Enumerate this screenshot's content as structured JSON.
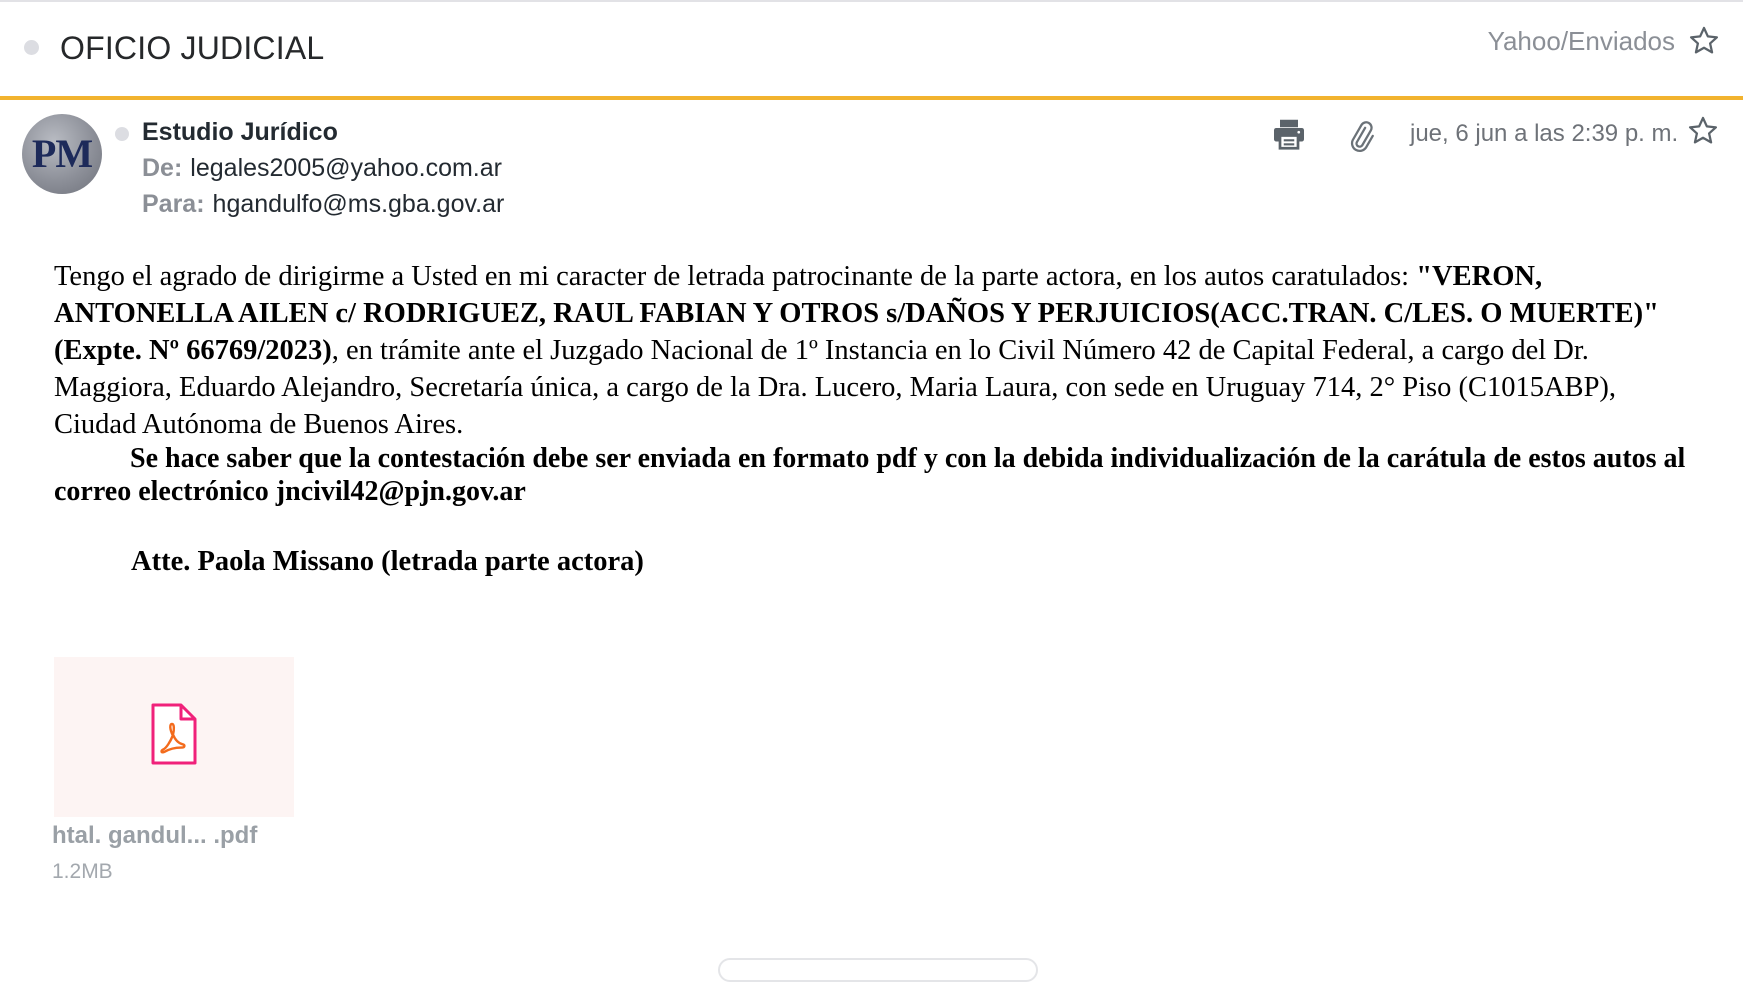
{
  "header": {
    "subject": "OFICIO JUDICIAL",
    "folder": "Yahoo/Enviados",
    "accent_color": "#f2b32e"
  },
  "message": {
    "avatar_initials": "PM",
    "sender_name": "Estudio Jurídico",
    "from_label": "De:",
    "from_address": "legales2005@yahoo.com.ar",
    "to_label": "Para:",
    "to_address": "hgandulfo@ms.gba.gov.ar",
    "date": "jue, 6 jun a las 2:39 p. m.",
    "icons": [
      "print-icon",
      "paperclip-icon",
      "star-icon"
    ]
  },
  "body": {
    "p1_a": "Tengo el agrado de dirigirme a Usted en mi caracter de letrada patrocinante de la parte actora, en los autos caratulados: ",
    "p1_bold": "\"VERON, ANTONELLA AILEN c/ RODRIGUEZ, RAUL FABIAN Y OTROS s/DAÑOS Y PERJUICIOS(ACC.TRAN. C/LES. O MUERTE)\" (Expte. Nº 66769/2023)",
    "p1_b": ", en trámite ante el Juzgado Nacional de 1º Instancia en lo Civil Número 42 de Capital Federal, a  cargo del Dr. Maggiora, Eduardo Alejandro, Secretaría única, a cargo de la Dra. Lucero, Maria Laura, con sede en Uruguay 714, 2° Piso (C1015ABP), Ciudad Autónoma de Buenos Aires.",
    "notice": "Se hace saber que la contestación debe ser enviada en formato pdf y con la debida individualización de la carátula de estos autos al correo electrónico jncivil42@pjn.gov.ar",
    "signature": "Atte. Paola Missano (letrada parte actora)"
  },
  "attachment": {
    "name": "htal. gandul... .pdf",
    "size": "1.2MB",
    "icon": "pdf-icon",
    "icon_color": "#f0217a"
  }
}
